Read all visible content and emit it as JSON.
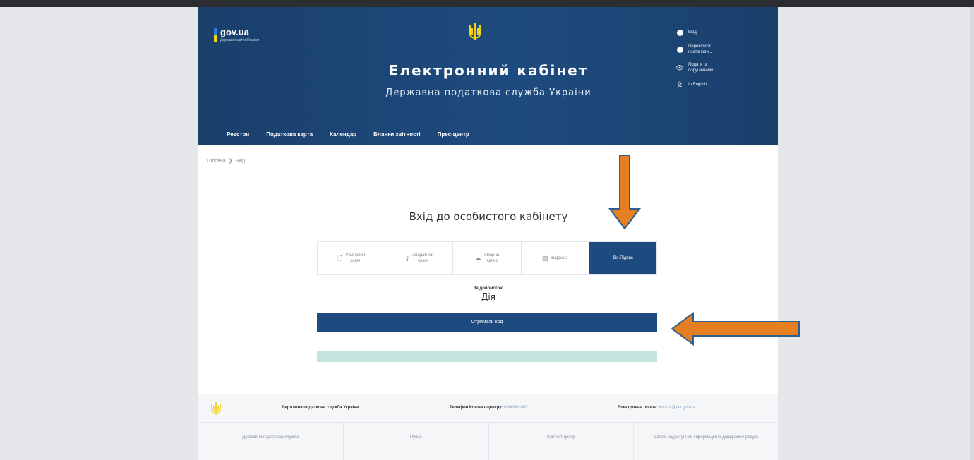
{
  "header": {
    "logo_text": "gov.ua",
    "logo_subtitle": "Державні сайти України",
    "title": "Електронний кабінет",
    "subtitle": "Державна податкова служба України",
    "links": [
      {
        "label": "Вхід",
        "icon": "login-icon"
      },
      {
        "label": "Перевірити\nпостанови…",
        "icon": "info-icon"
      },
      {
        "label": "Подати із\nпорушенням…",
        "icon": "eye-icon"
      },
      {
        "label": "In English",
        "icon": "translate-icon"
      }
    ],
    "nav": [
      "Реєстри",
      "Податкова карта",
      "Календар",
      "Бланки звітності",
      "Прес-центр"
    ]
  },
  "breadcrumb": {
    "home": "Головна",
    "separator": "❯",
    "current": "Вхід"
  },
  "login": {
    "title": "Вхід до особистого кабінету",
    "tabs": [
      {
        "label": "Файловий\nключ",
        "icon": "file-icon",
        "active": false
      },
      {
        "label": "Апаратний\nключ",
        "icon": "key-icon",
        "active": false
      },
      {
        "label": "Хмарна\nпідпис",
        "icon": "cloud-icon",
        "active": false
      },
      {
        "label": "id.gov.ua",
        "icon": "id-card-icon",
        "active": false
      },
      {
        "label": "Дія.Підпис",
        "icon": "",
        "active": true
      }
    ],
    "by_default": "За допомогою",
    "method": "Дія",
    "get_code": "Отримати код"
  },
  "footer": {
    "agency": "Державна податкова служба України",
    "phone_label": "Телефон Контакт-центру:",
    "phone_value": "0800501007",
    "email_label": "Електронна пошта:",
    "email_value": "info-cc@tax.gov.ua",
    "links": [
      "Державна податкова служба",
      "Пульс",
      "Контакт-центр",
      "Загальнодоступний інформаційно-довідковий ресурс"
    ]
  },
  "colors": {
    "header_bg": "#1e4b7f",
    "accent": "#1e4b7f",
    "arrow": "#e67e22",
    "progress": "#c4e4df"
  }
}
